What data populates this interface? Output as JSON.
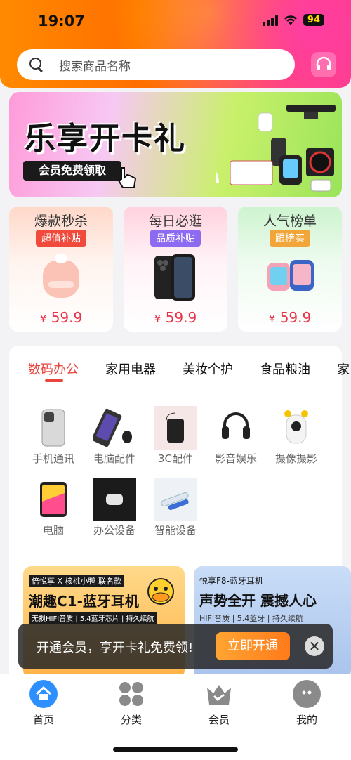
{
  "status_bar": {
    "time": "19:07",
    "battery": "94"
  },
  "search": {
    "placeholder": "搜索商品名称"
  },
  "banner": {
    "title": "乐享开卡礼",
    "cta": "会员免费领取"
  },
  "promos": [
    {
      "title": "爆款秒杀",
      "badge": "超值补贴",
      "badge_color": "#ef4a3c",
      "price_symbol": "¥",
      "price": "59.9"
    },
    {
      "title": "每日必逛",
      "badge": "品质补贴",
      "badge_color": "#8d6af2",
      "price_symbol": "¥",
      "price": "59.9"
    },
    {
      "title": "人气榜单",
      "badge": "跟榜买",
      "badge_color": "#f2a63a",
      "price_symbol": "¥",
      "price": "59.9"
    }
  ],
  "category_tabs": [
    "数码办公",
    "家用电器",
    "美妆个护",
    "食品粮油",
    "家"
  ],
  "categories": [
    {
      "label": "手机通讯",
      "icon": "phone-icon"
    },
    {
      "label": "电脑配件",
      "icon": "keyboard-icon"
    },
    {
      "label": "3C配件",
      "icon": "powerbank-icon"
    },
    {
      "label": "影音娱乐",
      "icon": "headphone-icon"
    },
    {
      "label": "摄像摄影",
      "icon": "camera-icon"
    },
    {
      "label": "电脑",
      "icon": "tablet-icon"
    },
    {
      "label": "办公设备",
      "icon": "printer-icon"
    },
    {
      "label": "智能设备",
      "icon": "pen-icon"
    }
  ],
  "tiles": [
    {
      "small": "倍悦享 X 核桃小鸭 联名款",
      "big": "潮趣C1-蓝牙耳机",
      "sub": "无损HIFI音质 | 5.4蓝牙芯片 | 持久续航"
    },
    {
      "small": "悦享F8-蓝牙耳机",
      "big": "声势全开 震撼人心",
      "sub": "HIFI音质 | 5.4蓝牙 | 持久续航"
    }
  ],
  "toast": {
    "text": "开通会员，享开卡礼免费领!",
    "button": "立即开通",
    "close": "✕"
  },
  "nav": [
    {
      "label": "首页",
      "color": "#2e8fff"
    },
    {
      "label": "分类",
      "color": "#8a8a8a"
    },
    {
      "label": "会员",
      "color": "#8a8a8a"
    },
    {
      "label": "我的",
      "color": "#8a8a8a"
    }
  ]
}
